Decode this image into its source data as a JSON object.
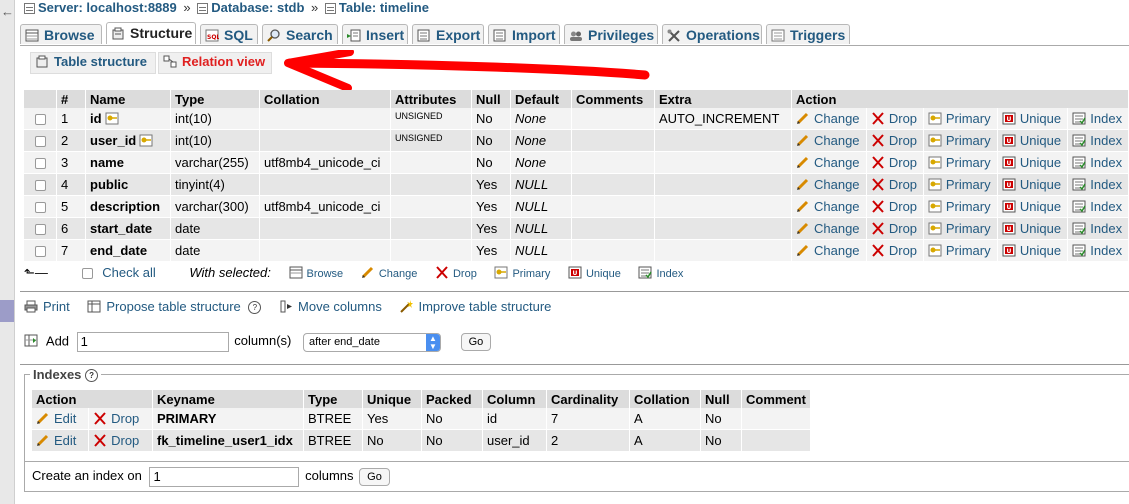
{
  "breadcrumb": {
    "server": "Server: localhost:8889",
    "database": "Database: stdb",
    "table": "Table: timeline",
    "separator": "»"
  },
  "tabs": [
    {
      "label": "Browse",
      "icon": "browse-icon"
    },
    {
      "label": "Structure",
      "icon": "structure-icon",
      "active": true
    },
    {
      "label": "SQL",
      "icon": "sql-icon"
    },
    {
      "label": "Search",
      "icon": "search-icon"
    },
    {
      "label": "Insert",
      "icon": "insert-icon"
    },
    {
      "label": "Export",
      "icon": "export-icon"
    },
    {
      "label": "Import",
      "icon": "import-icon"
    },
    {
      "label": "Privileges",
      "icon": "privileges-icon"
    },
    {
      "label": "Operations",
      "icon": "operations-icon"
    },
    {
      "label": "Triggers",
      "icon": "triggers-icon"
    }
  ],
  "subtabs": [
    {
      "label": "Table structure"
    },
    {
      "label": "Relation view"
    }
  ],
  "structure": {
    "headers": [
      "#",
      "Name",
      "Type",
      "Collation",
      "Attributes",
      "Null",
      "Default",
      "Comments",
      "Extra",
      "Action"
    ],
    "rows": [
      {
        "num": "1",
        "name": "id",
        "type": "int(10)",
        "collation": "",
        "attributes": "UNSIGNED",
        "null": "No",
        "default": "None",
        "comments": "",
        "extra": "AUTO_INCREMENT"
      },
      {
        "num": "2",
        "name": "user_id",
        "type": "int(10)",
        "collation": "",
        "attributes": "UNSIGNED",
        "null": "No",
        "default": "None",
        "comments": "",
        "extra": ""
      },
      {
        "num": "3",
        "name": "name",
        "type": "varchar(255)",
        "collation": "utf8mb4_unicode_ci",
        "attributes": "",
        "null": "No",
        "default": "None",
        "comments": "",
        "extra": ""
      },
      {
        "num": "4",
        "name": "public",
        "type": "tinyint(4)",
        "collation": "",
        "attributes": "",
        "null": "Yes",
        "default": "NULL",
        "comments": "",
        "extra": ""
      },
      {
        "num": "5",
        "name": "description",
        "type": "varchar(300)",
        "collation": "utf8mb4_unicode_ci",
        "attributes": "",
        "null": "Yes",
        "default": "NULL",
        "comments": "",
        "extra": ""
      },
      {
        "num": "6",
        "name": "start_date",
        "type": "date",
        "collation": "",
        "attributes": "",
        "null": "Yes",
        "default": "NULL",
        "comments": "",
        "extra": ""
      },
      {
        "num": "7",
        "name": "end_date",
        "type": "date",
        "collation": "",
        "attributes": "",
        "null": "Yes",
        "default": "NULL",
        "comments": "",
        "extra": ""
      }
    ],
    "actions": {
      "change": "Change",
      "drop": "Drop",
      "primary": "Primary",
      "unique": "Unique",
      "index": "Index"
    }
  },
  "with_selected": {
    "check_all": "Check all",
    "label": "With selected:",
    "browse": "Browse",
    "change": "Change",
    "drop": "Drop",
    "primary": "Primary",
    "unique": "Unique",
    "index": "Index"
  },
  "tools": {
    "print": "Print",
    "propose": "Propose table structure",
    "move": "Move columns",
    "improve": "Improve table structure"
  },
  "add_column": {
    "label": "Add",
    "value": "1",
    "unit": "column(s)",
    "position": "after end_date",
    "go": "Go"
  },
  "indexes": {
    "legend": "Indexes",
    "headers": [
      "Action",
      "Keyname",
      "Type",
      "Unique",
      "Packed",
      "Column",
      "Cardinality",
      "Collation",
      "Null",
      "Comment"
    ],
    "edit": "Edit",
    "drop": "Drop",
    "rows": [
      {
        "keyname": "PRIMARY",
        "type": "BTREE",
        "unique": "Yes",
        "packed": "No",
        "column": "id",
        "cardinality": "7",
        "collation": "A",
        "null": "No",
        "comment": ""
      },
      {
        "keyname": "fk_timeline_user1_idx",
        "type": "BTREE",
        "unique": "No",
        "packed": "No",
        "column": "user_id",
        "cardinality": "2",
        "collation": "A",
        "null": "No",
        "comment": ""
      }
    ]
  },
  "create_index": {
    "label": "Create an index on",
    "value": "1",
    "unit": "columns",
    "go": "Go"
  },
  "colors": {
    "link": "#235a81",
    "highlight": "#e02020",
    "annotation_arrow": "#ff0000"
  }
}
